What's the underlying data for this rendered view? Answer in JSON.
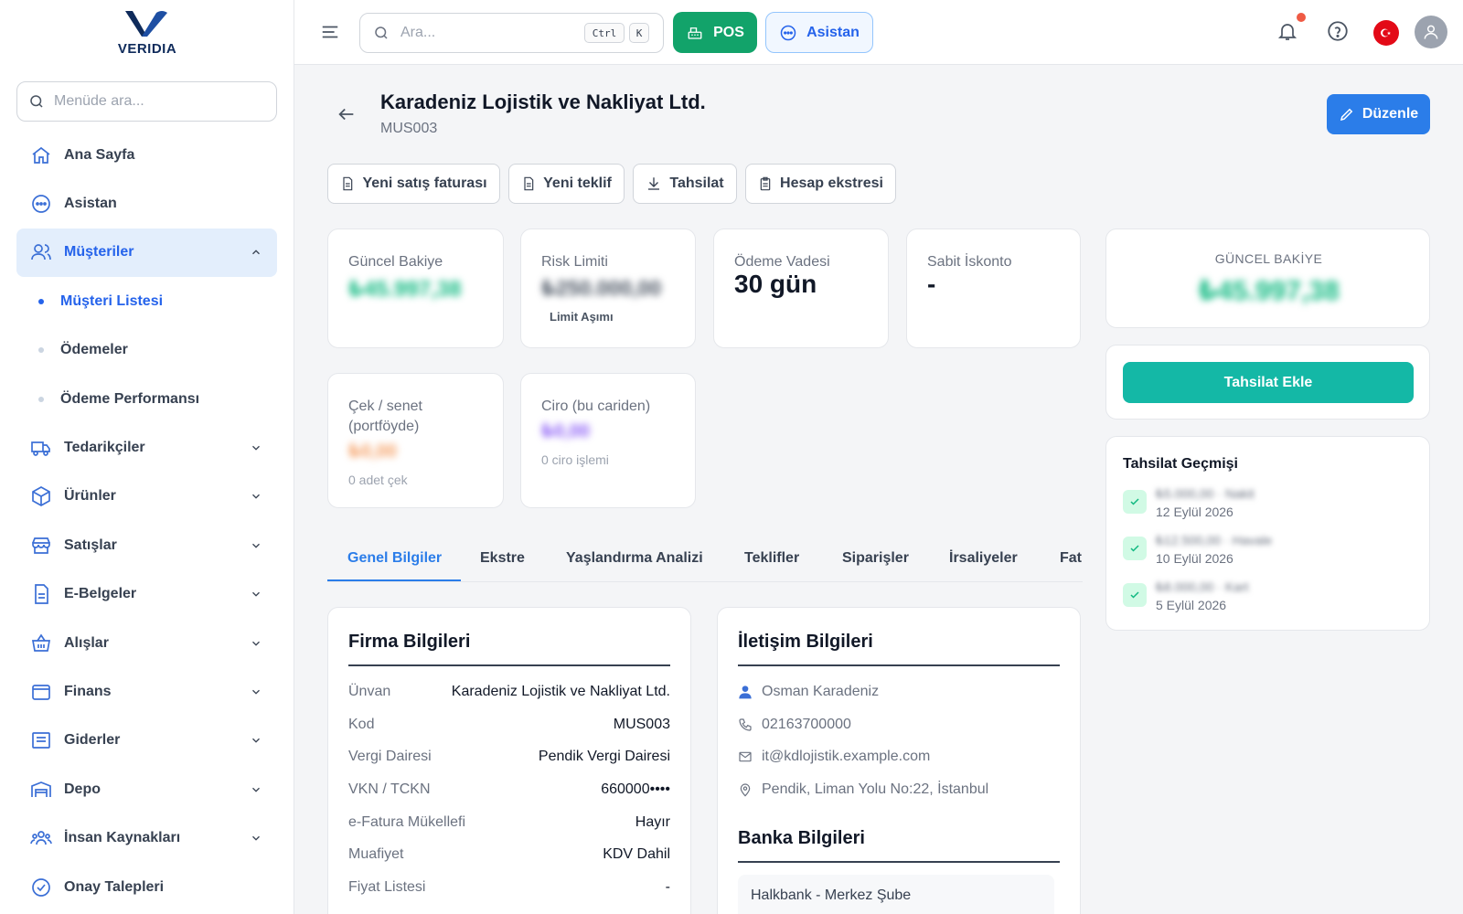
{
  "brand": {
    "name": "VERIDIA"
  },
  "sidebar": {
    "search_placeholder": "Menüde ara...",
    "items": [
      {
        "label": "Ana Sayfa"
      },
      {
        "label": "Asistan"
      },
      {
        "label": "Müşteriler",
        "expanded": true
      },
      {
        "label": "Tedarikçiler"
      },
      {
        "label": "Ürünler"
      },
      {
        "label": "Satışlar"
      },
      {
        "label": "E-Belgeler"
      },
      {
        "label": "Alışlar"
      },
      {
        "label": "Finans"
      },
      {
        "label": "Giderler"
      },
      {
        "label": "Depo"
      },
      {
        "label": "İnsan Kaynakları"
      },
      {
        "label": "Onay Talepleri"
      }
    ],
    "subitems": [
      {
        "label": "Müşteri Listesi",
        "active": true
      },
      {
        "label": "Ödemeler"
      },
      {
        "label": "Ödeme Performansı"
      }
    ]
  },
  "topbar": {
    "search_placeholder": "Ara...",
    "kbd_ctrl": "Ctrl",
    "kbd_k": "K",
    "pos_label": "POS",
    "asistan_label": "Asistan"
  },
  "header": {
    "title": "Karadeniz Lojistik ve Nakliyat Ltd.",
    "code": "MUS003",
    "edit_label": "Düzenle"
  },
  "actions": [
    "Yeni satış faturası",
    "Yeni teklif",
    "Tahsilat",
    "Hesap ekstresi"
  ],
  "stats": {
    "balance_label": "Güncel Bakiye",
    "balance_value": "₺45.997,38",
    "risk_label": "Risk Limiti",
    "risk_value": "₺250.000,00",
    "risk_note": "Limit Aşımı",
    "term_label": "Ödeme Vadesi",
    "term_value": "30 gün",
    "discount_label": "Sabit İskonto",
    "discount_value": "-",
    "cheque_label_1": "Çek / senet",
    "cheque_label_2": "(portföyde)",
    "cheque_value": "₺0,00",
    "cheque_note": "0 adet çek",
    "turnover_label": "Ciro (bu cariden)",
    "turnover_value": "₺0,00",
    "turnover_note": "0 ciro işlemi"
  },
  "right_panel": {
    "balance_title": "GÜNCEL BAKİYE",
    "balance_value": "₺45.997,38",
    "collect_button": "Tahsilat Ekle",
    "history_title": "Tahsilat Geçmişi",
    "history": [
      {
        "amount": "₺5.000,00 · Nakit",
        "date": "12 Eylül 2026"
      },
      {
        "amount": "₺12.500,00 · Havale",
        "date": "10 Eylül 2026"
      },
      {
        "amount": "₺8.000,00 · Kart",
        "date": "5 Eylül 2026"
      }
    ]
  },
  "tabs": [
    "Genel Bilgiler",
    "Ekstre",
    "Yaşlandırma Analizi",
    "Teklifler",
    "Siparişler",
    "İrsaliyeler",
    "Fat"
  ],
  "company": {
    "title": "Firma Bilgileri",
    "rows": [
      {
        "k": "Ünvan",
        "v": "Karadeniz Lojistik ve Nakliyat Ltd."
      },
      {
        "k": "Kod",
        "v": "MUS003"
      },
      {
        "k": "Vergi Dairesi",
        "v": "Pendik Vergi Dairesi"
      },
      {
        "k": "VKN / TCKN",
        "v": "660000••••"
      },
      {
        "k": "e-Fatura Mükellefi",
        "v": "Hayır"
      },
      {
        "k": "Muafiyet",
        "v": "KDV Dahil"
      },
      {
        "k": "Fiyat Listesi",
        "v": "-"
      }
    ]
  },
  "contact": {
    "title": "İletişim Bilgileri",
    "person": "Osman Karadeniz",
    "phone": "02163700000",
    "email": "it@kdlojistik.example.com",
    "address": "Pendik, Liman Yolu No:22, İstanbul",
    "bank_title": "Banka Bilgileri",
    "bank_name": "Halkbank - Merkez Şube"
  },
  "colors": {
    "primary": "#2b7de9",
    "pos": "#12a36a",
    "teal": "#14b8a6"
  }
}
